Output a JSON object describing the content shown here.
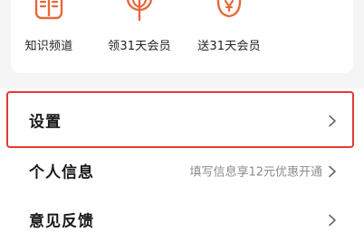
{
  "quick_actions": [
    {
      "label": "知识频道",
      "icon": "book-icon"
    },
    {
      "label": "领31天会员",
      "icon": "sprout-icon"
    },
    {
      "label": "送31天会员",
      "icon": "gift-pouch-icon"
    }
  ],
  "menu": {
    "items": [
      {
        "label": "设置",
        "hint": ""
      },
      {
        "label": "个人信息",
        "hint": "填写信息享12元优惠开通"
      },
      {
        "label": "意见反馈",
        "hint": ""
      }
    ]
  },
  "colors": {
    "accent": "#e8673a",
    "highlight": "#e53935"
  }
}
